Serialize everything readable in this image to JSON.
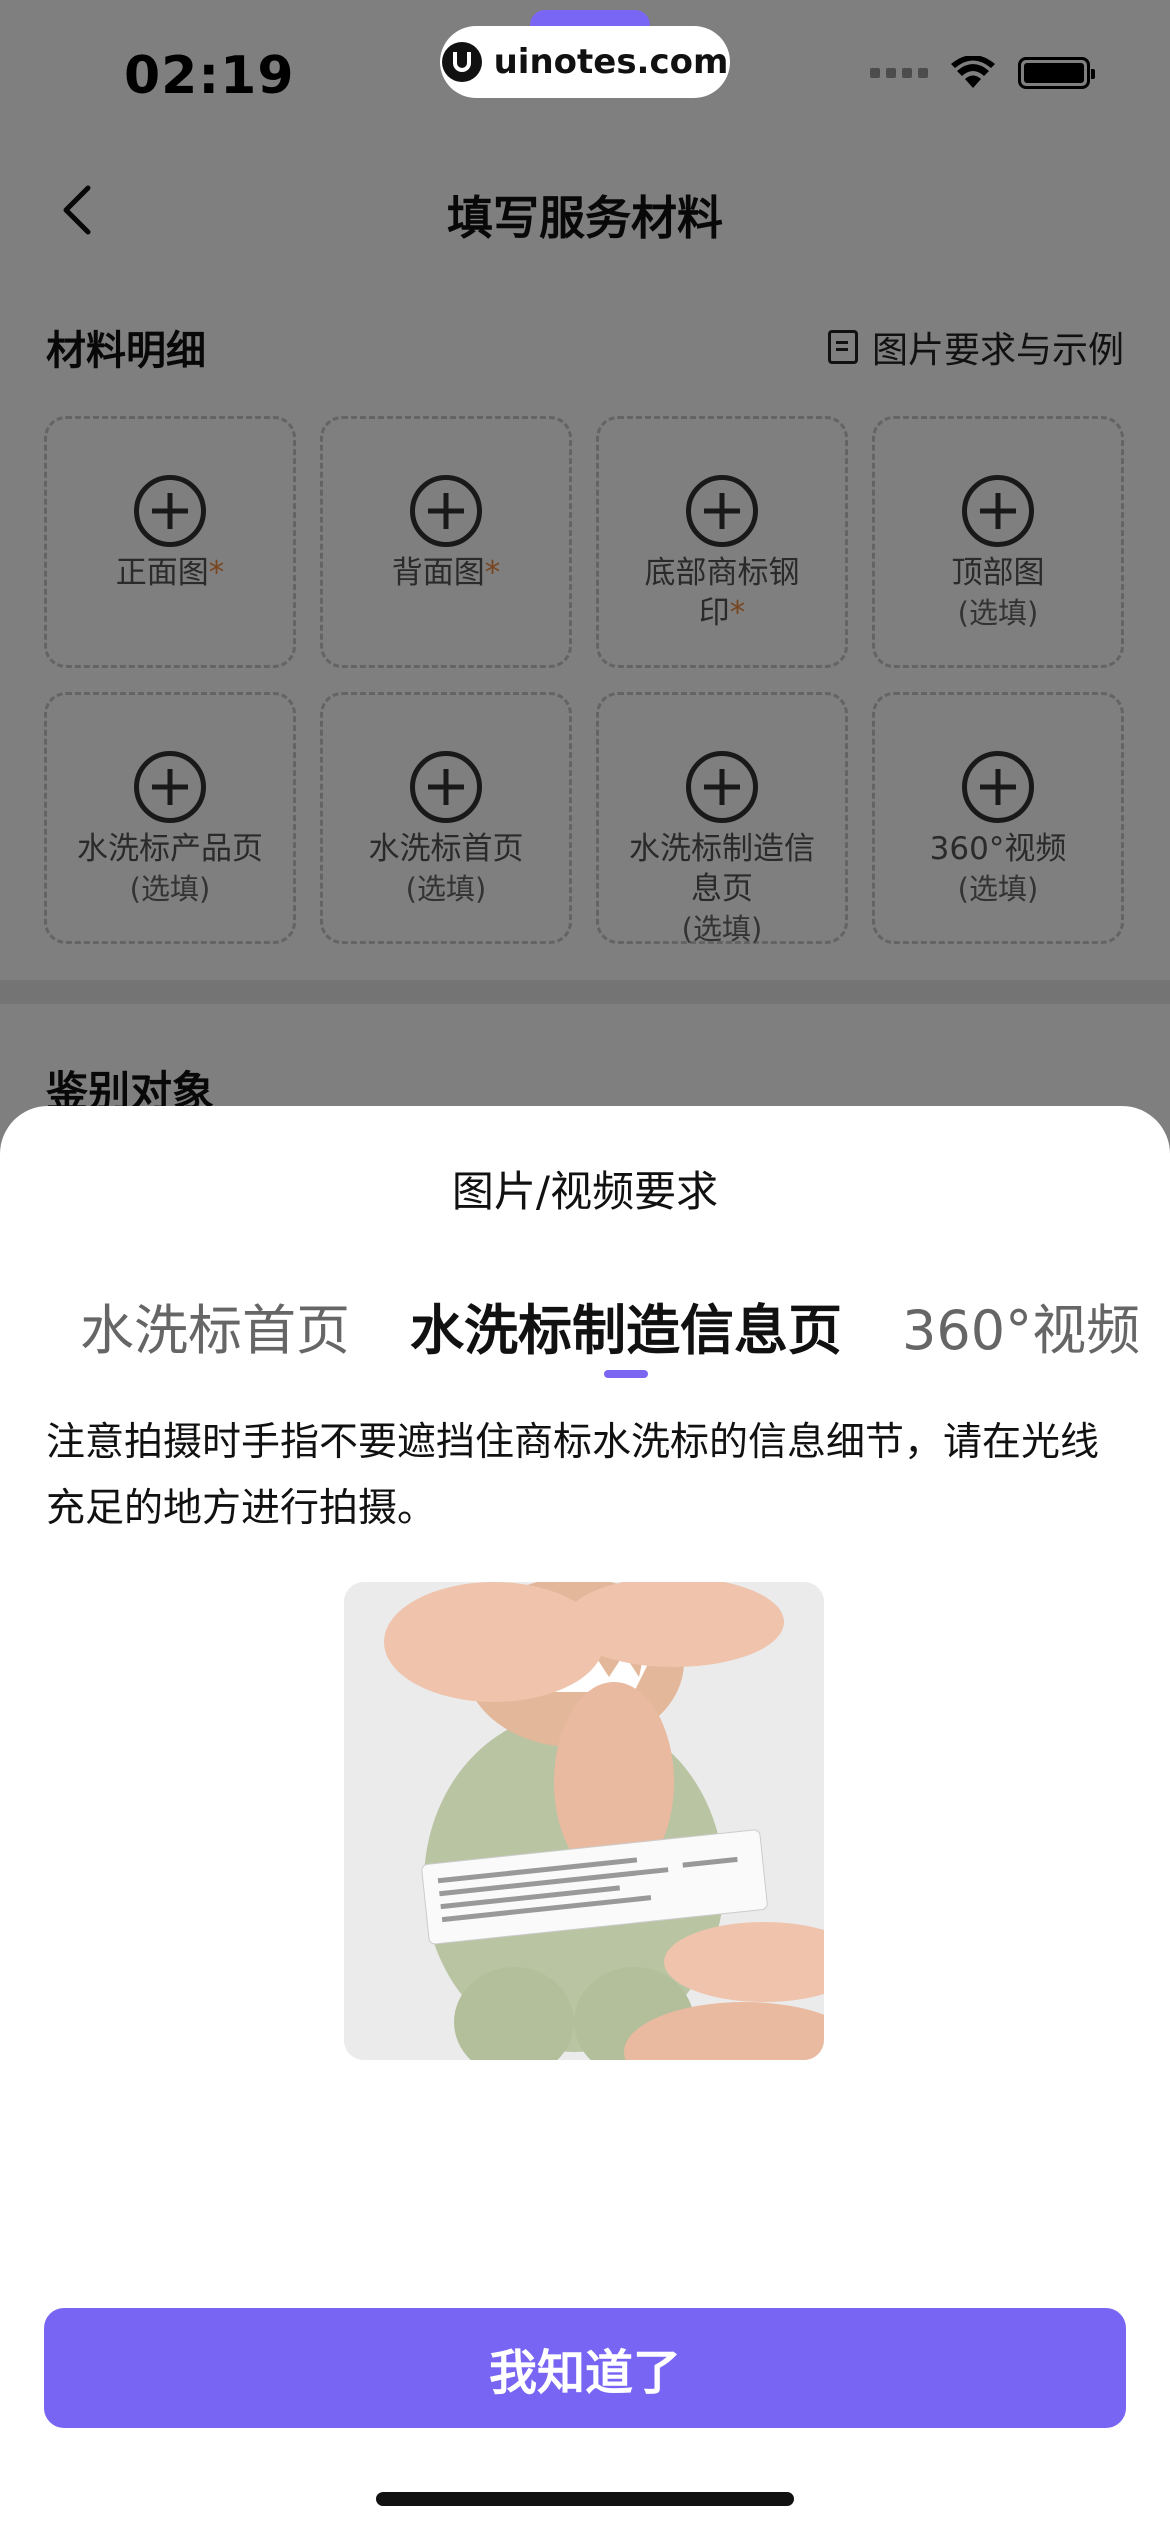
{
  "status_bar": {
    "time": "02:19",
    "watermark": "uinotes.com"
  },
  "nav": {
    "title": "填写服务材料"
  },
  "materials": {
    "title": "材料明细",
    "requirements_link": "图片要求与示例",
    "items": [
      {
        "label": "正面图",
        "required": "*",
        "optional": ""
      },
      {
        "label": "背面图",
        "required": "*",
        "optional": ""
      },
      {
        "label": "底部商标钢印",
        "required": "*",
        "optional": ""
      },
      {
        "label": "顶部图",
        "required": "",
        "optional": "(选填)"
      },
      {
        "label": "水洗标产品页",
        "required": "",
        "optional": "(选填)"
      },
      {
        "label": "水洗标首页",
        "required": "",
        "optional": "(选填)"
      },
      {
        "label": "水洗标制造信息页",
        "required": "",
        "optional": "(选填)"
      },
      {
        "label": "360°视频",
        "required": "",
        "optional": "(选填)"
      }
    ]
  },
  "identify": {
    "title": "鉴别对象"
  },
  "sheet": {
    "title": "图片/视频要求",
    "tabs": [
      {
        "label": "水洗标首页"
      },
      {
        "label": "水洗标制造信息页"
      },
      {
        "label": "360°视频"
      }
    ],
    "active_tab": 1,
    "description": "注意拍摄时手指不要遮挡住商标水洗标的信息细节，请在光线充足的地方进行拍摄。",
    "button": "我知道了"
  },
  "colors": {
    "accent": "#7865f3",
    "required_star": "#f08a3c"
  }
}
